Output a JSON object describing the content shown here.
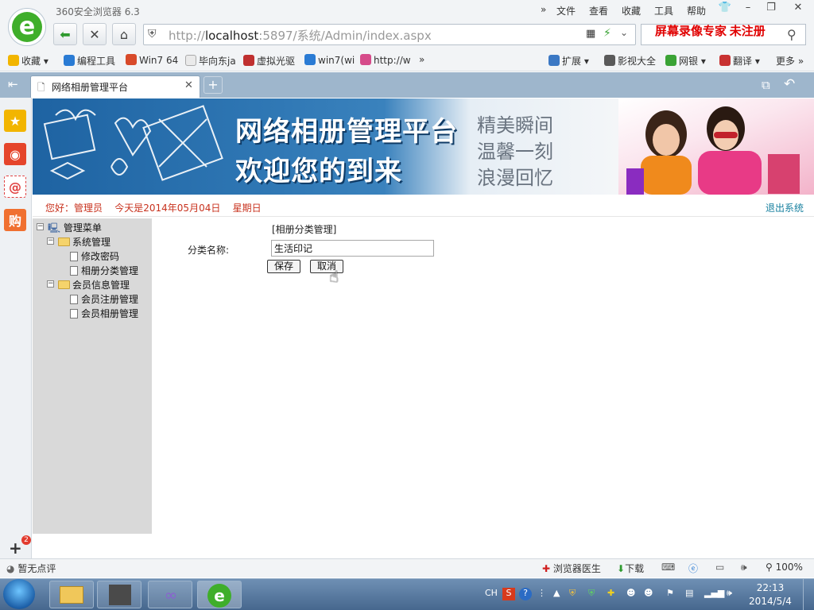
{
  "browser": {
    "app_title": "360安全浏览器 6.3",
    "menu": [
      "文件",
      "查看",
      "收藏",
      "工具",
      "帮助"
    ],
    "url_prefix": "http://",
    "url_host": "localhost",
    "url_rest": ":5897/系统/Admin/index.aspx",
    "watermark": "屏幕录像专家  未注册",
    "bookmarks": [
      "收藏",
      "编程工具",
      "Win7 64",
      "毕向东ja",
      "虚拟光驱",
      "win7(wi",
      "http://w"
    ],
    "right_tools": [
      "扩展",
      "影视大全",
      "网银",
      "翻译",
      "更多"
    ],
    "tab_title": "网络相册管理平台"
  },
  "banner": {
    "line1": "网络相册管理平台",
    "line2": "欢迎您的到来",
    "slogans": [
      "精美瞬间",
      "温馨一刻",
      "浪漫回忆"
    ]
  },
  "header": {
    "welcome": "您好：管理员    今天是2014年05月04日    星期日",
    "logout": "退出系统"
  },
  "sidebar": {
    "root": "管理菜单",
    "groups": [
      {
        "label": "系统管理",
        "items": [
          "修改密码",
          "相册分类管理"
        ]
      },
      {
        "label": "会员信息管理",
        "items": [
          "会员注册管理",
          "会员相册管理"
        ]
      }
    ]
  },
  "form": {
    "title": "[相册分类管理]",
    "field_label": "分类名称:",
    "field_value": "生活印记",
    "save": "保存",
    "cancel": "取消"
  },
  "status": {
    "rating": "暂无点评",
    "doctor": "浏览器医生",
    "download": "下载",
    "zoom": "100%",
    "badge": "2"
  },
  "taskbar": {
    "lang": "CH",
    "time": "22:13",
    "date": "2014/5/4"
  }
}
